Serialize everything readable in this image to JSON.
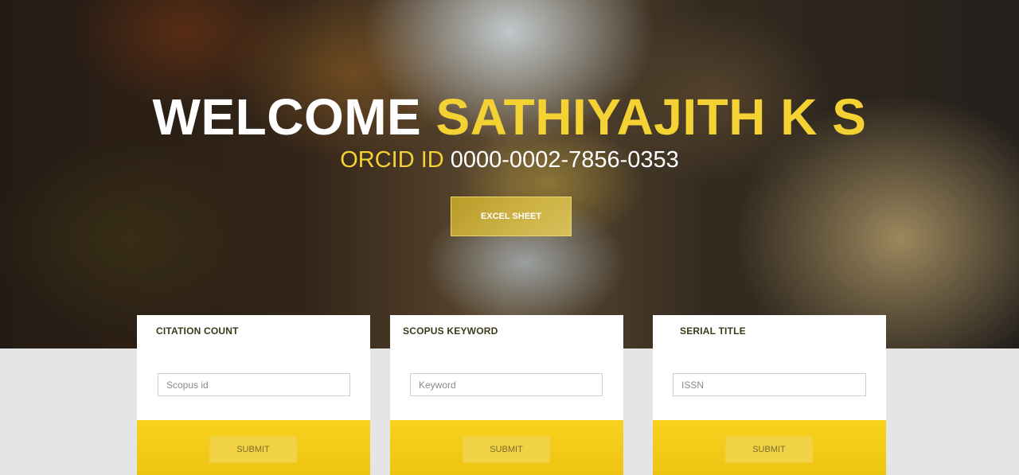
{
  "hero": {
    "welcome_word": "WELCOME",
    "user_name": "SATHIYAJITH K S",
    "orcid_label": "ORCID ID",
    "orcid_value": "0000-0002-7856-0353",
    "excel_button_label": "EXCEL SHEET"
  },
  "cards": [
    {
      "title": "CITATION COUNT",
      "input_placeholder": "Scopus id",
      "input_value": "",
      "submit_label": "SUBMIT"
    },
    {
      "title": "SCOPUS KEYWORD",
      "input_placeholder": "Keyword",
      "input_value": "",
      "submit_label": "SUBMIT"
    },
    {
      "title": "SERIAL TITLE",
      "input_placeholder": "ISSN",
      "input_value": "",
      "submit_label": "SUBMIT"
    }
  ],
  "colors": {
    "accent_yellow": "#f5d234",
    "footer_yellow": "#f8d11e",
    "page_background": "#e5e5e5"
  }
}
